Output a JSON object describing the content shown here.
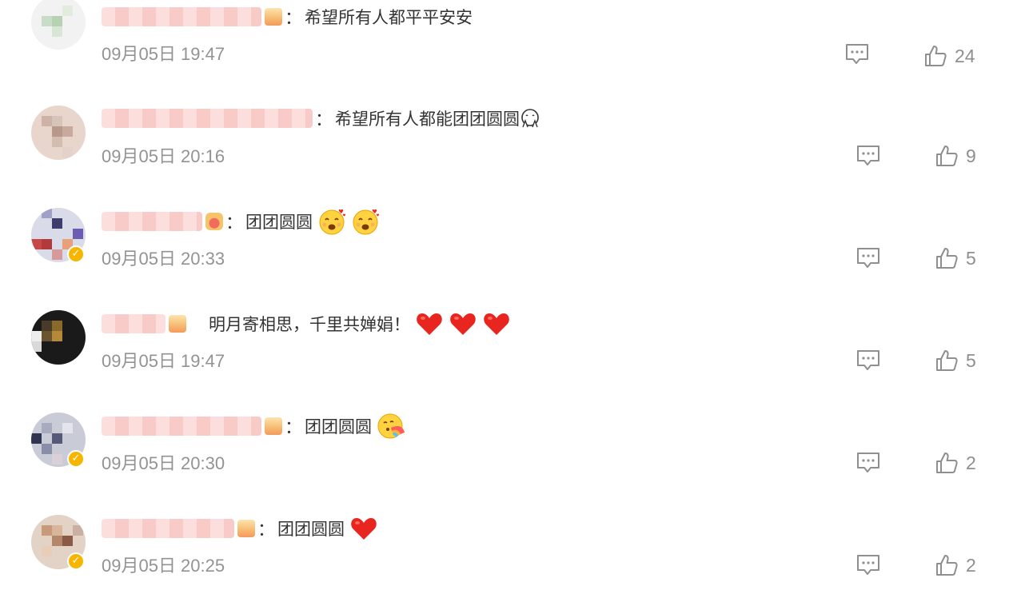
{
  "comments": [
    {
      "id": "c1",
      "text": "希望所有人都平平安安",
      "time": "09月05日 19:47",
      "likes": "24",
      "emojis": [],
      "verified": false
    },
    {
      "id": "c2",
      "text": "希望所有人都能团团圆圆",
      "time": "09月05日 20:16",
      "likes": "9",
      "emojis": [
        "hugging-face-icon"
      ],
      "verified": false
    },
    {
      "id": "c3",
      "text": "团团圆圆",
      "time": "09月05日 20:33",
      "likes": "5",
      "emojis": [
        "smiling-face-with-hearts-icon",
        "smiling-face-with-hearts-icon"
      ],
      "verified": true
    },
    {
      "id": "c4",
      "text": "明月寄相思，千里共婵娟！",
      "time": "09月05日 19:47",
      "likes": "5",
      "emojis": [
        "red-heart-icon",
        "red-heart-icon",
        "red-heart-icon"
      ],
      "verified": false
    },
    {
      "id": "c5",
      "text": "团团圆圆",
      "time": "09月05日 20:30",
      "likes": "2",
      "emojis": [
        "rainbow-face-icon"
      ],
      "verified": true
    },
    {
      "id": "c6",
      "text": "团团圆圆",
      "time": "09月05日 20:25",
      "likes": "2",
      "emojis": [
        "red-heart-icon"
      ],
      "verified": true
    }
  ],
  "separator": "：",
  "colors": {
    "text": "#333333",
    "meta": "#939393",
    "icon": "#8f8f8f",
    "verified": "#f7b500",
    "heart": "#e8261f"
  }
}
